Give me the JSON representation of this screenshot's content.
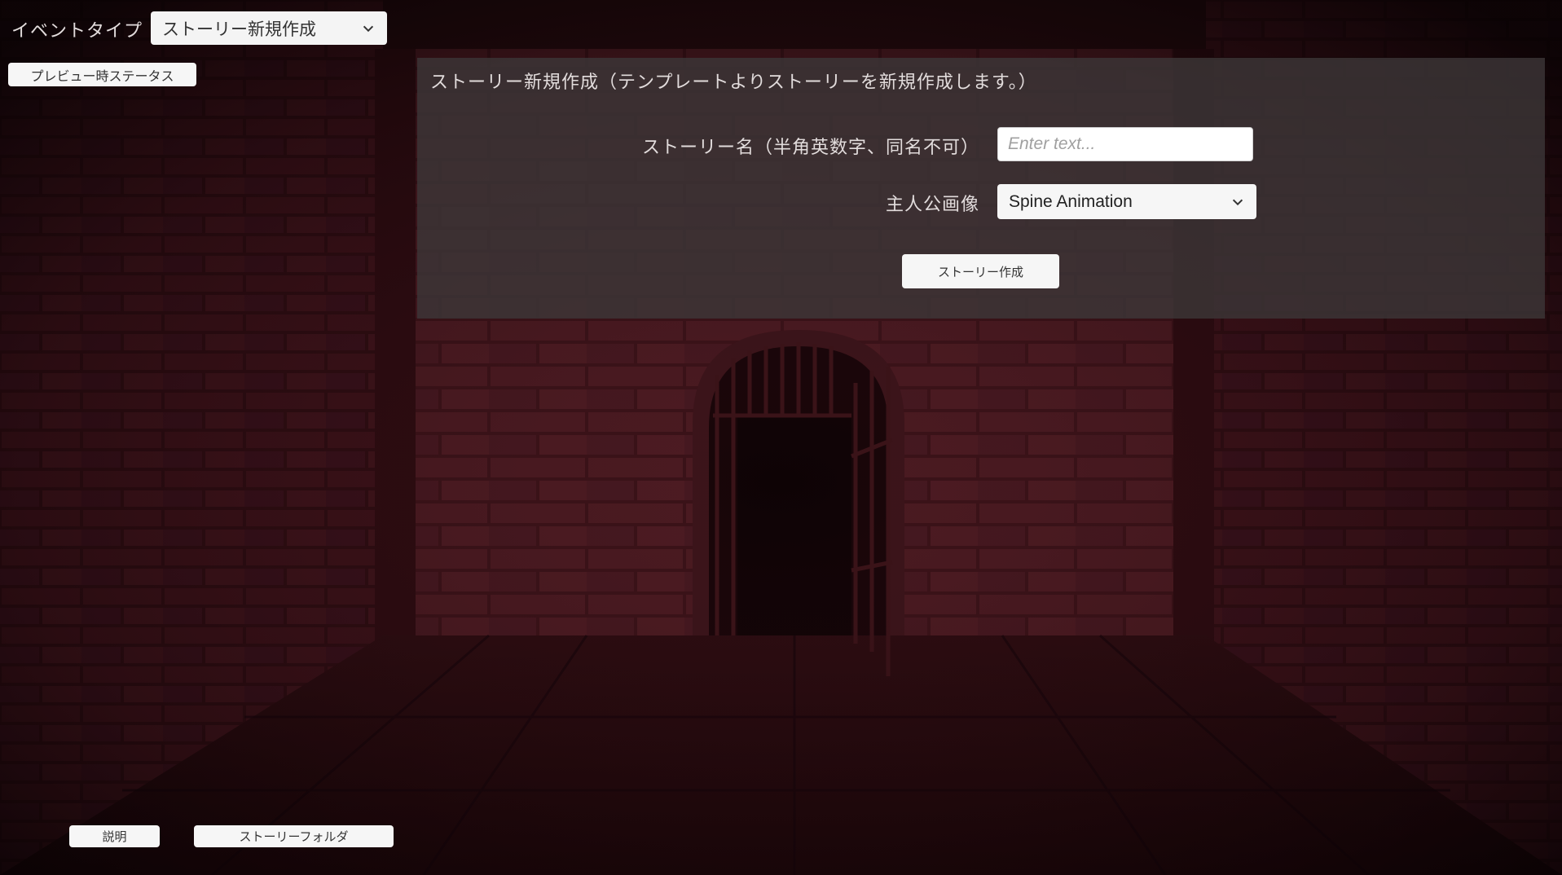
{
  "header": {
    "event_type_label": "イベントタイプ",
    "event_type_value": "ストーリー新規作成",
    "preview_status_button": "プレビュー時ステータス"
  },
  "panel": {
    "title": "ストーリー新規作成（テンプレートよりストーリーを新規作成します。）",
    "story_name_label": "ストーリー名（半角英数字、同名不可）",
    "story_name_placeholder": "Enter text...",
    "story_name_value": "",
    "hero_image_label": "主人公画像",
    "hero_image_value": "Spine Animation",
    "create_button": "ストーリー作成"
  },
  "footer": {
    "help_button": "説明",
    "story_folder_button": "ストーリーフォルダ"
  },
  "colors": {
    "background_dark": "#1a0709",
    "brick_red": "#3a1016",
    "panel_overlay": "#3c3637"
  }
}
